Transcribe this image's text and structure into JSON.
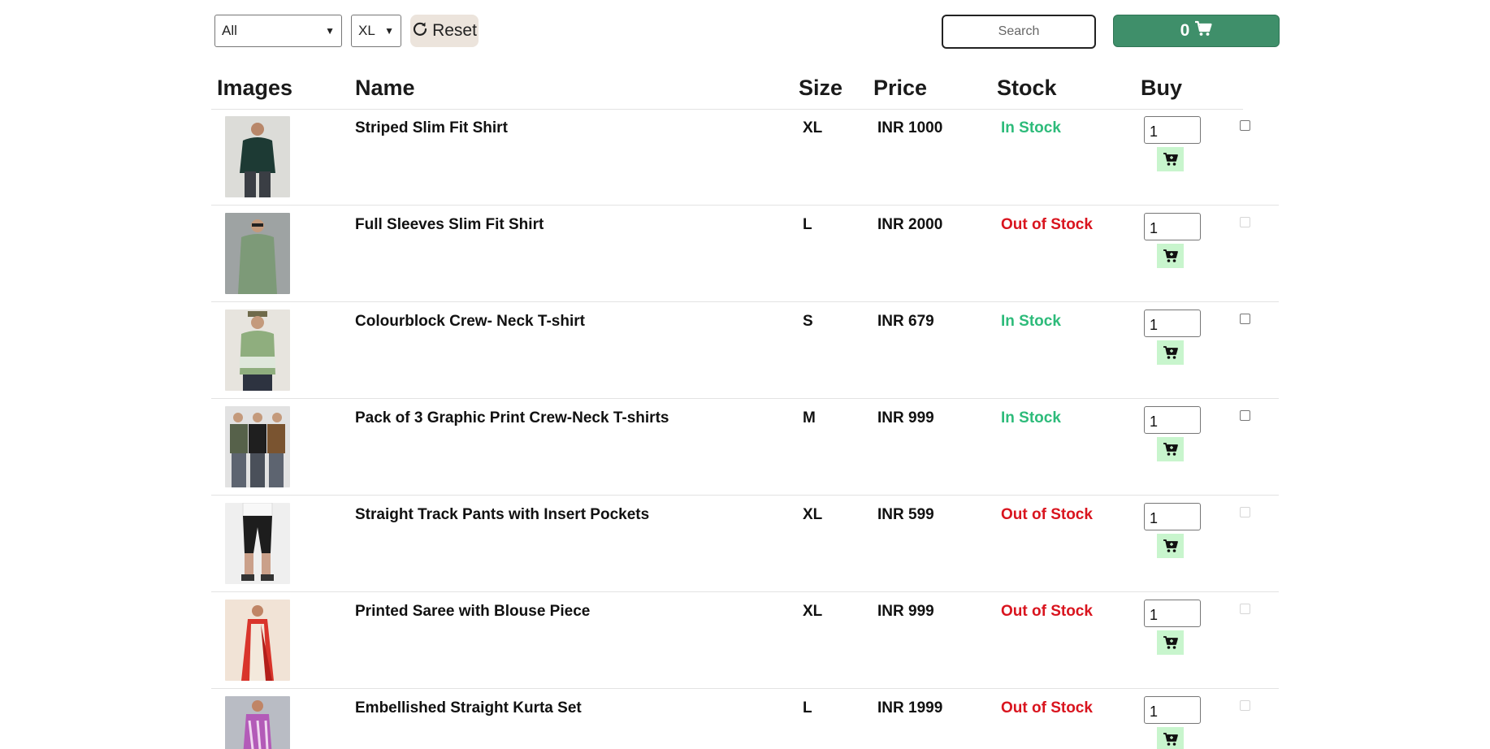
{
  "toolbar": {
    "category_select": "All",
    "size_select": "XL",
    "reset_label": "Reset",
    "search_placeholder": "Search",
    "cart_count": "0"
  },
  "table": {
    "headers": [
      "Images",
      "Name",
      "Size",
      "Price",
      "Stock",
      "Buy"
    ],
    "rows": [
      {
        "name": "Striped Slim Fit Shirt",
        "size": "XL",
        "price": "INR 1000",
        "stock": "In Stock",
        "in_stock": true,
        "qty": "1",
        "image": "shirt-dark"
      },
      {
        "name": "Full Sleeves Slim Fit Shirt",
        "size": "L",
        "price": "INR 2000",
        "stock": "Out of Stock",
        "in_stock": false,
        "qty": "1",
        "image": "shirt-green"
      },
      {
        "name": "Colourblock Crew- Neck T-shirt",
        "size": "S",
        "price": "INR 679",
        "stock": "In Stock",
        "in_stock": true,
        "qty": "1",
        "image": "tshirt-green"
      },
      {
        "name": "Pack of 3 Graphic Print Crew-Neck T-shirts",
        "size": "M",
        "price": "INR 999",
        "stock": "In Stock",
        "in_stock": true,
        "qty": "1",
        "image": "tshirt-pack"
      },
      {
        "name": "Straight Track Pants with Insert Pockets",
        "size": "XL",
        "price": "INR 599",
        "stock": "Out of Stock",
        "in_stock": false,
        "qty": "1",
        "image": "track-pants"
      },
      {
        "name": "Printed Saree with Blouse Piece",
        "size": "XL",
        "price": "INR 999",
        "stock": "Out of Stock",
        "in_stock": false,
        "qty": "1",
        "image": "saree-red"
      },
      {
        "name": "Embellished Straight Kurta Set",
        "size": "L",
        "price": "INR 1999",
        "stock": "Out of Stock",
        "in_stock": false,
        "qty": "1",
        "image": "kurta-purple"
      }
    ]
  },
  "colors": {
    "in_stock": "#2dbb7a",
    "out_of_stock": "#d9141e",
    "cart_button": "#3f8f6a",
    "add_button": "#c8f5cd",
    "reset_button": "#ece4dc"
  }
}
